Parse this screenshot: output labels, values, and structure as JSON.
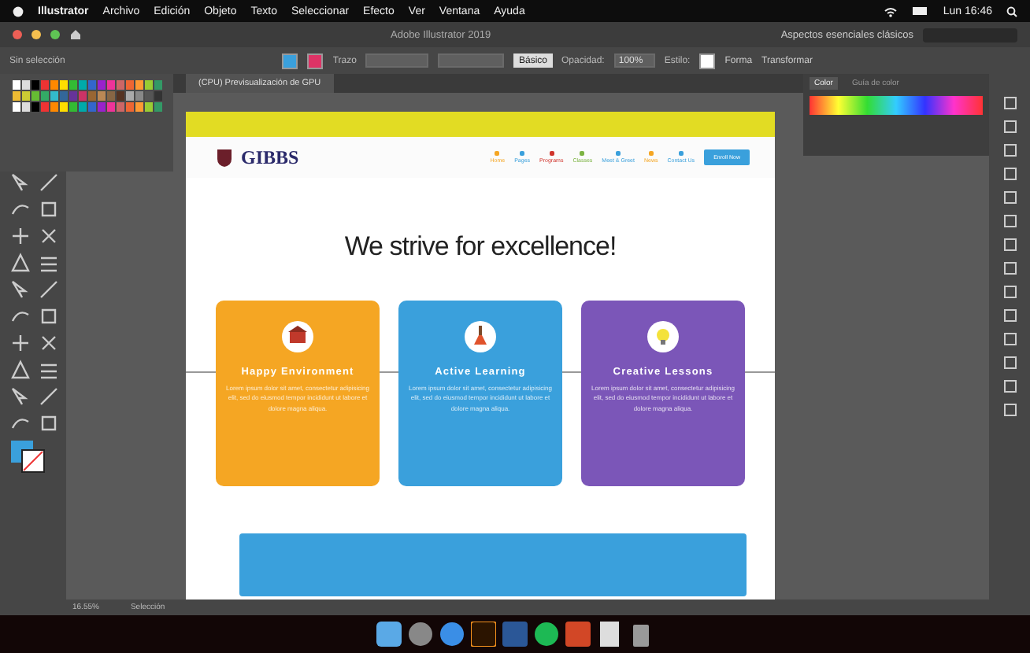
{
  "menu_bar": {
    "items": [
      "Illustrator",
      "Archivo",
      "Edición",
      "Objeto",
      "Texto",
      "Seleccionar",
      "Efecto",
      "Ver",
      "Ventana",
      "Ayuda"
    ],
    "clock": "Lun 16:46"
  },
  "window": {
    "title": "Adobe Illustrator 2019",
    "workspace": "Aspectos esenciales clásicos"
  },
  "control_bar": {
    "selection_label": "Sin selección",
    "stroke_label": "Trazo",
    "brush": "Básico",
    "opacity_label": "Opacidad:",
    "opacity": "100%",
    "style_label": "Estilo:",
    "buttons": [
      "Forma",
      "Transformar"
    ]
  },
  "document_tab": {
    "label": "(CPU) Previsualización de GPU"
  },
  "color_panel": {
    "tabs": [
      {
        "label": "Color",
        "selected": true
      },
      {
        "label": "Guía de color",
        "selected": false
      }
    ]
  },
  "artboard": {
    "logo": "GIBBS",
    "nav": [
      {
        "label": "Home",
        "color": "#f5a623"
      },
      {
        "label": "Pages",
        "color": "#3aa0dc"
      },
      {
        "label": "Programs",
        "color": "#d0342c"
      },
      {
        "label": "Classes",
        "color": "#7cb342"
      },
      {
        "label": "Meet & Greet",
        "color": "#3aa0dc"
      },
      {
        "label": "News",
        "color": "#f5a623"
      },
      {
        "label": "Contact Us",
        "color": "#3aa0dc"
      }
    ],
    "button": "Enroll Now",
    "headline": "We strive for excellence!",
    "cards": [
      {
        "kind": "school",
        "color": "#f5a623",
        "title": "Happy Environment",
        "text": "Lorem ipsum dolor sit amet, consectetur adipisicing elit, sed do eiusmod tempor incididunt ut labore et dolore magna aliqua."
      },
      {
        "kind": "flask",
        "color": "#3aa0dc",
        "title": "Active Learning",
        "text": "Lorem ipsum dolor sit amet, consectetur adipisicing elit, sed do eiusmod tempor incididunt ut labore et dolore magna aliqua."
      },
      {
        "kind": "bulb",
        "color": "#7b56b8",
        "title": "Creative Lessons",
        "text": "Lorem ipsum dolor sit amet, consectetur adipisicing elit, sed do eiusmod tempor incididunt ut labore et dolore magna aliqua."
      }
    ]
  },
  "status_bar": {
    "zoom": "16.55%",
    "tool": "Selección"
  }
}
